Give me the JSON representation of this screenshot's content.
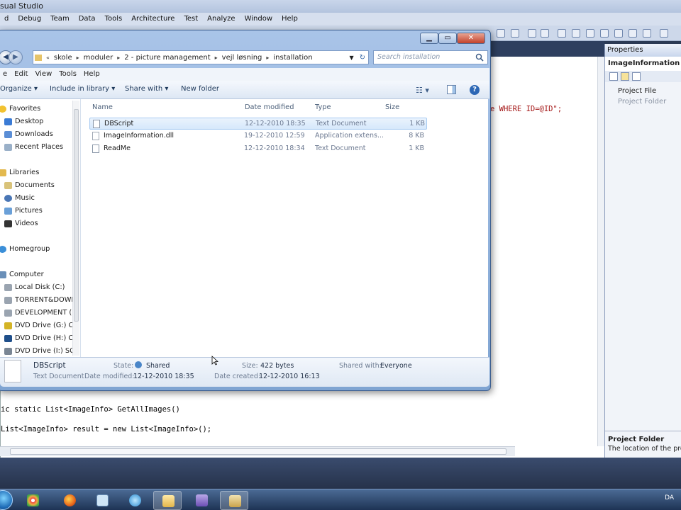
{
  "vs": {
    "title": "sual Studio",
    "menu": [
      "d",
      "Debug",
      "Team",
      "Data",
      "Tools",
      "Architecture",
      "Test",
      "Analyze",
      "Window",
      "Help"
    ],
    "code": {
      "line1_tail": "e WHERE ID=@ID\";",
      "line2": "ic static List<ImageInfo> GetAllImages()",
      "line3": "List<ImageInfo> result = new List<ImageInfo>();"
    },
    "properties": {
      "title": "Properties",
      "object": "ImageInformation Pro",
      "rows": [
        "Project File",
        "Project Folder"
      ],
      "desc_title": "Project Folder",
      "desc_text": "The location of the proj"
    }
  },
  "explorer": {
    "address": [
      "skole",
      "moduler",
      "2 - picture management",
      "vejl løsning",
      "installation"
    ],
    "search_placeholder": "Search installation",
    "menu": [
      "e",
      "Edit",
      "View",
      "Tools",
      "Help"
    ],
    "commands": {
      "organize": "Organize ▾",
      "include": "Include in library ▾",
      "share": "Share with ▾",
      "new_folder": "New folder"
    },
    "nav": {
      "favorites": "Favorites",
      "desktop": "Desktop",
      "downloads": "Downloads",
      "recent": "Recent Places",
      "libraries": "Libraries",
      "documents": "Documents",
      "music": "Music",
      "pictures": "Pictures",
      "videos": "Videos",
      "homegroup": "Homegroup",
      "computer": "Computer",
      "local_disk": "Local Disk (C:)",
      "torrent": "TORRENT&DOWN",
      "development": "DEVELOPMENT (F",
      "dvd_g": "DVD Drive (G:) Cr",
      "dvd_h": "DVD Drive (H:) Ca",
      "dvd_i": "DVD Drive (I:) SC"
    },
    "columns": {
      "name": "Name",
      "date": "Date modified",
      "type": "Type",
      "size": "Size"
    },
    "files": [
      {
        "name": "DBScript",
        "date": "12-12-2010 18:35",
        "type": "Text Document",
        "size": "1 KB"
      },
      {
        "name": "ImageInformation.dll",
        "date": "19-12-2010 12:59",
        "type": "Application extens...",
        "size": "8 KB"
      },
      {
        "name": "ReadMe",
        "date": "12-12-2010 18:34",
        "type": "Text Document",
        "size": "1 KB"
      }
    ],
    "details": {
      "name": "DBScript",
      "type": "Text Document",
      "state_label": "State:",
      "state_value": "Shared",
      "size_label": "Size:",
      "size_value": "422 bytes",
      "shared_label": "Shared with:",
      "shared_value": "Everyone",
      "modified_label": "Date modified:",
      "modified_value": "12-12-2010 18:35",
      "created_label": "Date created:",
      "created_value": "12-12-2010 16:13"
    }
  },
  "taskbar": {
    "language": "DA"
  }
}
